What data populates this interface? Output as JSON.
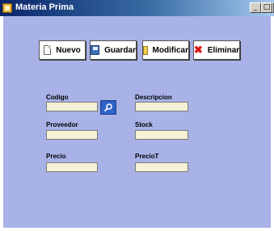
{
  "window": {
    "title": "Materia Prima",
    "controls": {
      "minimize": "_",
      "maximize": "□",
      "close": "x"
    }
  },
  "toolbar": {
    "nuevo": "Nuevo",
    "guardar": "Guardar",
    "modificar": "Modificar",
    "eliminar": "Eliminar"
  },
  "form": {
    "codigo_label": "Codigo",
    "codigo_value": "",
    "descripcion_label": "Descripcion",
    "descripcion_value": "",
    "proveedor_label": "Proveedor",
    "proveedor_value": "",
    "stock_label": "Stock",
    "stock_value": "",
    "precio_label": "Precio",
    "precio_value": "",
    "preciot_label": "PrecioT",
    "preciot_value": ""
  },
  "icons": {
    "app": "app-icon",
    "nuevo": "new-document-icon",
    "guardar": "save-disk-icon",
    "modificar": "edit-icon",
    "eliminar": "delete-x-icon",
    "buscar": "search-icon"
  },
  "colors": {
    "client_background": "#a9b2e6",
    "titlebar_start": "#0a246a",
    "field_background": "#f5f1d6",
    "search_button": "#2f63c9",
    "delete_icon": "#dd1111"
  }
}
